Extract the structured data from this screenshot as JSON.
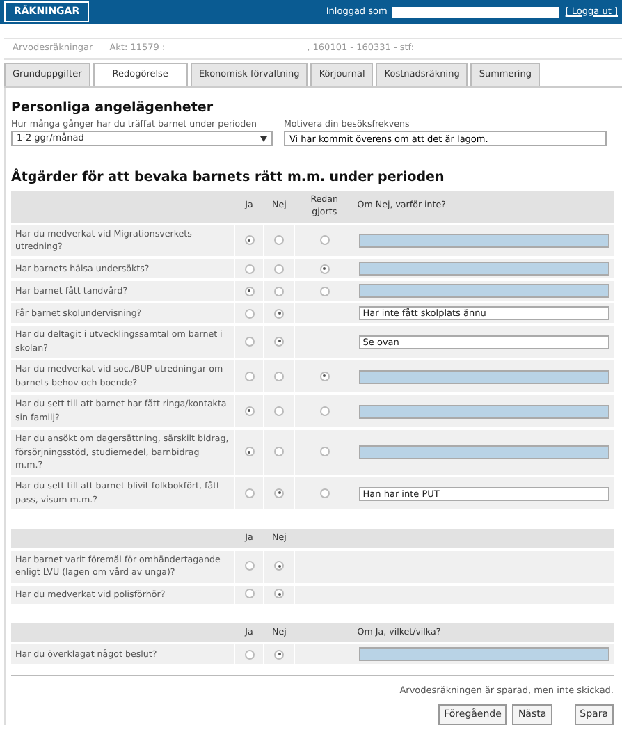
{
  "header": {
    "brand": "RÄKNINGAR",
    "login_label": "Inloggad som",
    "logout": "[ Logga ut ]"
  },
  "breadcrumb": [
    "Arvodesräkningar",
    "Akt: 11579 :",
    ", 160101 - 160331 - stf:"
  ],
  "tabs": [
    {
      "label": "Grunduppgifter",
      "selected": false
    },
    {
      "label": "Redogörelse",
      "selected": true
    },
    {
      "label": "Ekonomisk förvaltning",
      "selected": false
    },
    {
      "label": "Körjournal",
      "selected": false
    },
    {
      "label": "Kostnadsräkning",
      "selected": false
    },
    {
      "label": "Summering",
      "selected": false
    }
  ],
  "personal": {
    "title": "Personliga angelägenheter",
    "frequency_label": "Hur många gånger har du träffat barnet under perioden",
    "frequency_value": "1-2 ggr/månad",
    "motivation_label": "Motivera din besöksfrekvens",
    "motivation_value": "Vi har kommit överens om att det är lagom."
  },
  "measures_title": "Åtgärder för att bevaka barnets rätt m.m. under perioden",
  "tables": [
    {
      "columns": [
        "Ja",
        "Nej",
        "Redan gjorts",
        "Om Nej, varför inte?"
      ],
      "rows": [
        {
          "question": "Har du medverkat vid Migrationsverkets utredning?",
          "choices": [
            {
              "selected": true
            },
            {
              "selected": false
            },
            {
              "selected": false
            }
          ],
          "reason": {
            "disabled": true
          }
        },
        {
          "question": "Har barnets hälsa undersökts?",
          "choices": [
            {
              "selected": false
            },
            {
              "selected": false
            },
            {
              "selected": true
            }
          ],
          "reason": {
            "disabled": true
          }
        },
        {
          "question": "Har barnet fått tandvård?",
          "choices": [
            {
              "selected": true
            },
            {
              "selected": false
            },
            {
              "selected": false
            }
          ],
          "reason": {
            "disabled": true
          }
        },
        {
          "question": "Får barnet skolundervisning?",
          "choices": [
            {
              "selected": false
            },
            {
              "selected": true
            }
          ],
          "reason": {
            "disabled": false,
            "value": "Har inte fått skolplats ännu"
          }
        },
        {
          "question": "Har du deltagit i utvecklingssamtal om barnet i skolan?",
          "choices": [
            {
              "selected": false
            },
            {
              "selected": true
            }
          ],
          "reason": {
            "disabled": false,
            "value": "Se ovan"
          }
        },
        {
          "question": "Har du medverkat vid soc./BUP utredningar om barnets behov och boende?",
          "choices": [
            {
              "selected": false
            },
            {
              "selected": false
            },
            {
              "selected": true
            }
          ],
          "reason": {
            "disabled": true
          }
        },
        {
          "question": "Har du sett till att barnet har fått ringa/kontakta sin familj?",
          "choices": [
            {
              "selected": true
            },
            {
              "selected": false
            },
            {
              "selected": false
            }
          ],
          "reason": {
            "disabled": true
          }
        },
        {
          "question": "Har du ansökt om dagersättning, särskilt bidrag, försörjningsstöd, studiemedel, barnbidrag m.m.?",
          "choices": [
            {
              "selected": true
            },
            {
              "selected": false
            },
            {
              "selected": false
            }
          ],
          "reason": {
            "disabled": true
          }
        },
        {
          "question": "Har du sett till att barnet blivit folkbokfört, fått pass, visum m.m.?",
          "choices": [
            {
              "selected": false
            },
            {
              "selected": true
            },
            {
              "selected": false
            }
          ],
          "reason": {
            "disabled": false,
            "value": "Han har inte PUT"
          }
        }
      ]
    },
    {
      "columns": [
        "Ja",
        "Nej"
      ],
      "rows": [
        {
          "question": "Har barnet varit föremål för omhändertagande enligt LVU (lagen om vård av unga)?",
          "choices": [
            {
              "selected": false
            },
            {
              "selected": true
            }
          ]
        },
        {
          "question": "Har du medverkat vid polisförhör?",
          "choices": [
            {
              "selected": false
            },
            {
              "selected": true
            }
          ]
        }
      ]
    },
    {
      "columns": [
        "Ja",
        "Nej",
        "Om Ja, vilket/vilka?"
      ],
      "rows": [
        {
          "question": "Har du överklagat något beslut?",
          "choices": [
            {
              "selected": false
            },
            {
              "selected": true
            }
          ],
          "reason": {
            "disabled": true
          }
        }
      ]
    }
  ],
  "status": "Arvodesräkningen är sparad, men inte skickad.",
  "buttons": [
    "Föregående",
    "Nästa",
    "Spara"
  ]
}
